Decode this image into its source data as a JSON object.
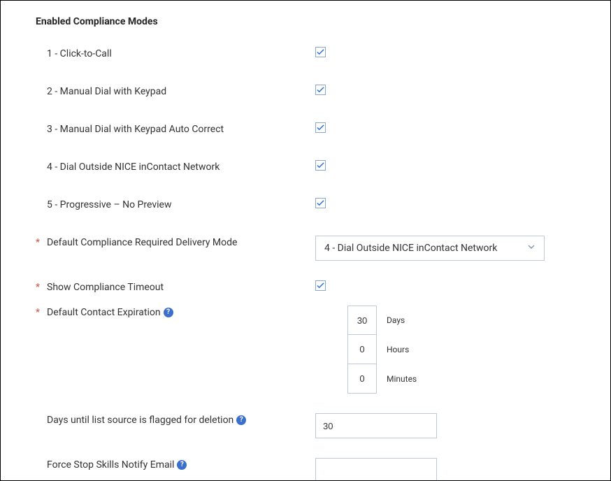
{
  "section_title": "Enabled Compliance Modes",
  "modes": [
    {
      "label": "1 - Click-to-Call",
      "checked": true
    },
    {
      "label": "2 - Manual Dial with Keypad",
      "checked": true
    },
    {
      "label": "3 - Manual Dial with Keypad Auto Correct",
      "checked": true
    },
    {
      "label": "4 - Dial Outside NICE inContact Network",
      "checked": true
    },
    {
      "label": "5 - Progressive – No Preview",
      "checked": true
    }
  ],
  "delivery_mode": {
    "label": "Default Compliance Required Delivery Mode",
    "selected": "4 - Dial Outside NICE inContact Network"
  },
  "compliance_timeout": {
    "label": "Show Compliance Timeout",
    "checked": true
  },
  "contact_expiration": {
    "label": "Default Contact Expiration",
    "days": {
      "value": "30",
      "unit": "Days"
    },
    "hours": {
      "value": "0",
      "unit": "Hours"
    },
    "minutes": {
      "value": "0",
      "unit": "Minutes"
    }
  },
  "flag_deletion": {
    "label": "Days until list source is flagged for deletion",
    "value": "30"
  },
  "notify_email": {
    "label": "Force Stop Skills Notify Email",
    "value": ""
  }
}
